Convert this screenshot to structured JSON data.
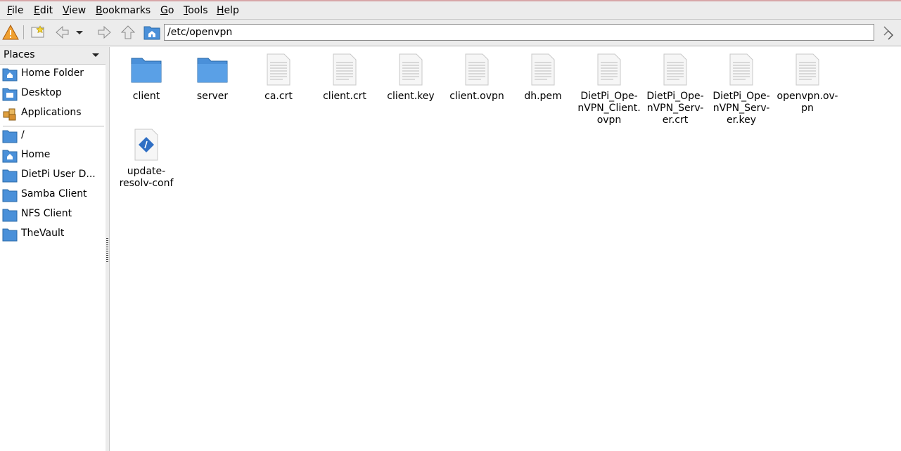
{
  "menubar": {
    "items": [
      "File",
      "Edit",
      "View",
      "Bookmarks",
      "Go",
      "Tools",
      "Help"
    ],
    "mnemonics": [
      "F",
      "E",
      "V",
      "B",
      "G",
      "T",
      "H"
    ]
  },
  "toolbar": {
    "path": "/etc/openvpn",
    "icons": [
      "warning-icon",
      "new-bookmark-icon",
      "back-icon",
      "history-dropdown-icon",
      "forward-icon",
      "up-icon",
      "home-folder-icon",
      "go-icon"
    ]
  },
  "sidepanel": {
    "title": "Places",
    "places": [
      {
        "label": "Home Folder",
        "icon": "home-folder-icon"
      },
      {
        "label": "Desktop",
        "icon": "desktop-icon"
      },
      {
        "label": "Applications",
        "icon": "applications-icon"
      }
    ],
    "bookmarks": [
      {
        "label": "/",
        "icon": "folder-icon"
      },
      {
        "label": "Home",
        "icon": "home-folder-icon"
      },
      {
        "label": "DietPi User D...",
        "icon": "folder-icon"
      },
      {
        "label": "Samba Client",
        "icon": "folder-icon"
      },
      {
        "label": "NFS Client",
        "icon": "folder-icon"
      },
      {
        "label": "TheVault",
        "icon": "folder-icon"
      }
    ]
  },
  "files": [
    {
      "name": "client",
      "type": "folder"
    },
    {
      "name": "server",
      "type": "folder"
    },
    {
      "name": "ca.crt",
      "type": "text"
    },
    {
      "name": "client.crt",
      "type": "text"
    },
    {
      "name": "client.key",
      "type": "text"
    },
    {
      "name": "client.ovpn",
      "type": "text"
    },
    {
      "name": "dh.pem",
      "type": "text"
    },
    {
      "name": "DietPi_Ope-\nnVPN_Client.\novpn",
      "type": "text"
    },
    {
      "name": "DietPi_Ope-\nnVPN_Serv-\ner.crt",
      "type": "text"
    },
    {
      "name": "DietPi_Ope-\nnVPN_Serv-\ner.key",
      "type": "text"
    },
    {
      "name": "openvpn.ov-\npn",
      "type": "text"
    },
    {
      "name": "update-\nresolv-conf",
      "type": "script"
    }
  ],
  "colors": {
    "folder": "#4a90d9",
    "chrome": "#ececec",
    "accent_border": "#d7a6a8"
  }
}
